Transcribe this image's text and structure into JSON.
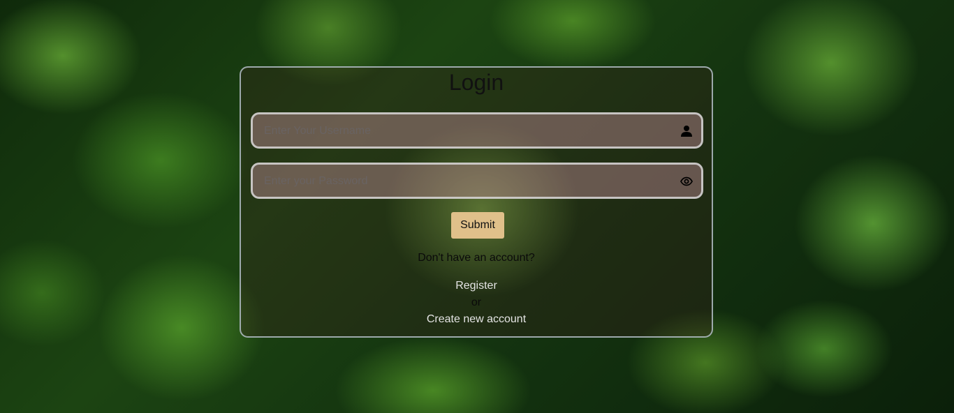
{
  "login": {
    "title": "Login",
    "username": {
      "value": "",
      "placeholder": "Enter Your Username",
      "icon": "user-icon"
    },
    "password": {
      "value": "",
      "placeholder": "Enter your Password",
      "icon": "eye-icon"
    },
    "submit_label": "Submit",
    "no_account_text": "Don't have an account?",
    "register_label": "Register",
    "or_text": "or",
    "create_account_label": "Create new account"
  },
  "colors": {
    "submit_button": "#e0c08a",
    "card_border": "#b4bec8",
    "link_text": "#e4e4e4"
  }
}
